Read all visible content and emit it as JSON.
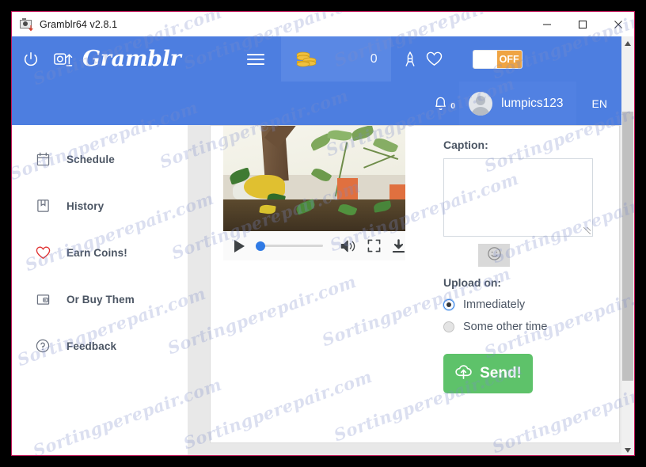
{
  "window": {
    "title": "Gramblr64 v2.8.1",
    "app_icon": "camera-upload-icon",
    "minimize_label": "Minimize",
    "maximize_label": "Maximize",
    "close_label": "Close"
  },
  "header": {
    "power_icon": "power-icon",
    "upload_icon": "camera-upload-icon",
    "brand": "Gramblr",
    "menu_icon": "hamburger-menu-icon",
    "coins": {
      "icon": "coins-stack-icon",
      "count": "0"
    },
    "tower_icon": "tower-icon",
    "heart_icon": "heart-icon",
    "toggle": {
      "state_label": "OFF",
      "on": false
    },
    "notifications": {
      "icon": "bell-icon",
      "badge": "0"
    },
    "user": {
      "avatar": "avatar-placeholder-icon",
      "name": "lumpics123"
    },
    "language": "EN",
    "accent_blue": "#4d7ee0",
    "accent_blue_dark": "#5181e2",
    "toggle_orange": "#efa443"
  },
  "sidebar": {
    "items": [
      {
        "label": "Schedule",
        "icon": "calendar-icon"
      },
      {
        "label": "History",
        "icon": "book-icon"
      },
      {
        "label": "Earn Coins!",
        "icon": "heart-icon"
      },
      {
        "label": "Or Buy Them",
        "icon": "card-icon"
      },
      {
        "label": "Feedback",
        "icon": "question-circle-icon"
      }
    ]
  },
  "main": {
    "video": {
      "alt": "garden scene with tree and orange pots",
      "controls": {
        "play_icon": "play-icon",
        "progress_percent": 0,
        "volume_icon": "volume-icon",
        "fullscreen_icon": "fullscreen-icon",
        "download_icon": "download-icon"
      }
    },
    "caption": {
      "label": "Caption:",
      "value": "",
      "placeholder": ""
    },
    "emoji_button": {
      "icon": "smiley-icon"
    },
    "upload_on": {
      "label": "Upload on:",
      "options": [
        {
          "label": "Immediately",
          "selected": true
        },
        {
          "label": "Some other time",
          "selected": false
        }
      ]
    },
    "send_button": {
      "label": "Send!",
      "icon": "cloud-upload-icon",
      "color": "#5ec26a"
    }
  },
  "watermark": {
    "text": "Sortingperepair.com"
  }
}
